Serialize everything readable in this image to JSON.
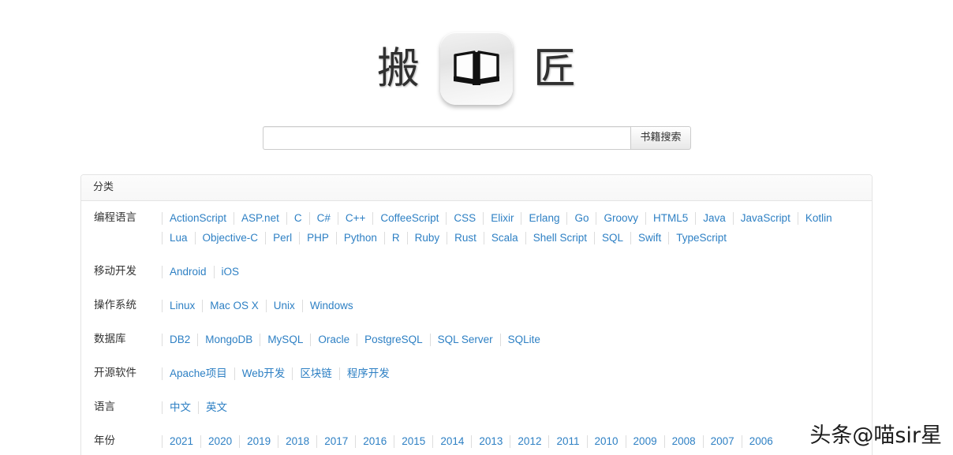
{
  "brand": {
    "left_char": "搬",
    "right_char": "匠",
    "icon_name": "open-book-icon"
  },
  "search": {
    "value": "",
    "placeholder": "",
    "button_label": "书籍搜索"
  },
  "panel": {
    "heading": "分类",
    "rows": [
      {
        "label": "编程语言",
        "links": [
          "ActionScript",
          "ASP.net",
          "C",
          "C#",
          "C++",
          "CoffeeScript",
          "CSS",
          "Elixir",
          "Erlang",
          "Go",
          "Groovy",
          "HTML5",
          "Java",
          "JavaScript",
          "Kotlin",
          "Lua",
          "Objective-C",
          "Perl",
          "PHP",
          "Python",
          "R",
          "Ruby",
          "Rust",
          "Scala",
          "Shell Script",
          "SQL",
          "Swift",
          "TypeScript"
        ]
      },
      {
        "label": "移动开发",
        "links": [
          "Android",
          "iOS"
        ]
      },
      {
        "label": "操作系统",
        "links": [
          "Linux",
          "Mac OS X",
          "Unix",
          "Windows"
        ]
      },
      {
        "label": "数据库",
        "links": [
          "DB2",
          "MongoDB",
          "MySQL",
          "Oracle",
          "PostgreSQL",
          "SQL Server",
          "SQLite"
        ]
      },
      {
        "label": "开源软件",
        "links": [
          "Apache项目",
          "Web开发",
          "区块链",
          "程序开发"
        ]
      },
      {
        "label": "语言",
        "links": [
          "中文",
          "英文"
        ]
      },
      {
        "label": "年份",
        "links": [
          "2021",
          "2020",
          "2019",
          "2018",
          "2017",
          "2016",
          "2015",
          "2014",
          "2013",
          "2012",
          "2011",
          "2010",
          "2009",
          "2008",
          "2007",
          "2006"
        ]
      }
    ]
  },
  "watermark": {
    "text": "头条@喵sir星"
  },
  "colors": {
    "link": "#2e80c4",
    "text": "#333333",
    "border": "#e4e4e4",
    "separator": "#dddddd",
    "background": "#ffffff"
  }
}
